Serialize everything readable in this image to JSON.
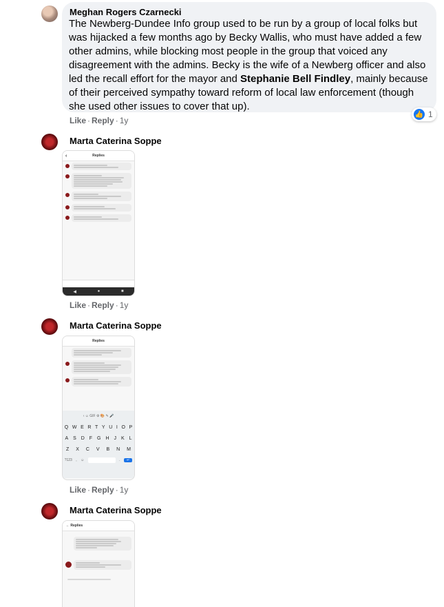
{
  "comment1": {
    "author": "Meghan Rogers Czarnecki",
    "text_parts": [
      "The Newberg-Dundee Info group used to be run by a group of local folks but was hijacked a few months ago by Becky Wallis, who must have added a few other admins, while blocking most people in the group that voiced any disagreement with the admins. Becky is the wife of a Newberg officer and also led the recall effort for the mayor and ",
      "Stephanie Bell Findley",
      ", mainly because of their perceived sympathy toward reform of local law enforcement (though she used other issues to cover that up)."
    ],
    "reaction_count": "1",
    "like": "Like",
    "reply": "Reply",
    "age": "1y"
  },
  "reply1": {
    "author": "Marta Caterina Soppe",
    "like": "Like",
    "reply": "Reply",
    "age": "1y"
  },
  "reply2": {
    "author": "Marta Caterina Soppe",
    "like": "Like",
    "reply": "Reply",
    "age": "1y"
  },
  "reply3": {
    "author": "Marta Caterina Soppe"
  },
  "shot_title": "Replies",
  "keyboard": {
    "row1": [
      "Q",
      "W",
      "E",
      "R",
      "T",
      "Y",
      "U",
      "I",
      "O",
      "P"
    ],
    "row2": [
      "A",
      "S",
      "D",
      "F",
      "G",
      "H",
      "J",
      "K",
      "L"
    ],
    "row3": [
      "Z",
      "X",
      "C",
      "V",
      "B",
      "N",
      "M"
    ]
  },
  "colors": {
    "like_blue": "#1877f2",
    "bubble_gray": "#f0f2f5",
    "meta_gray": "#65676b"
  }
}
